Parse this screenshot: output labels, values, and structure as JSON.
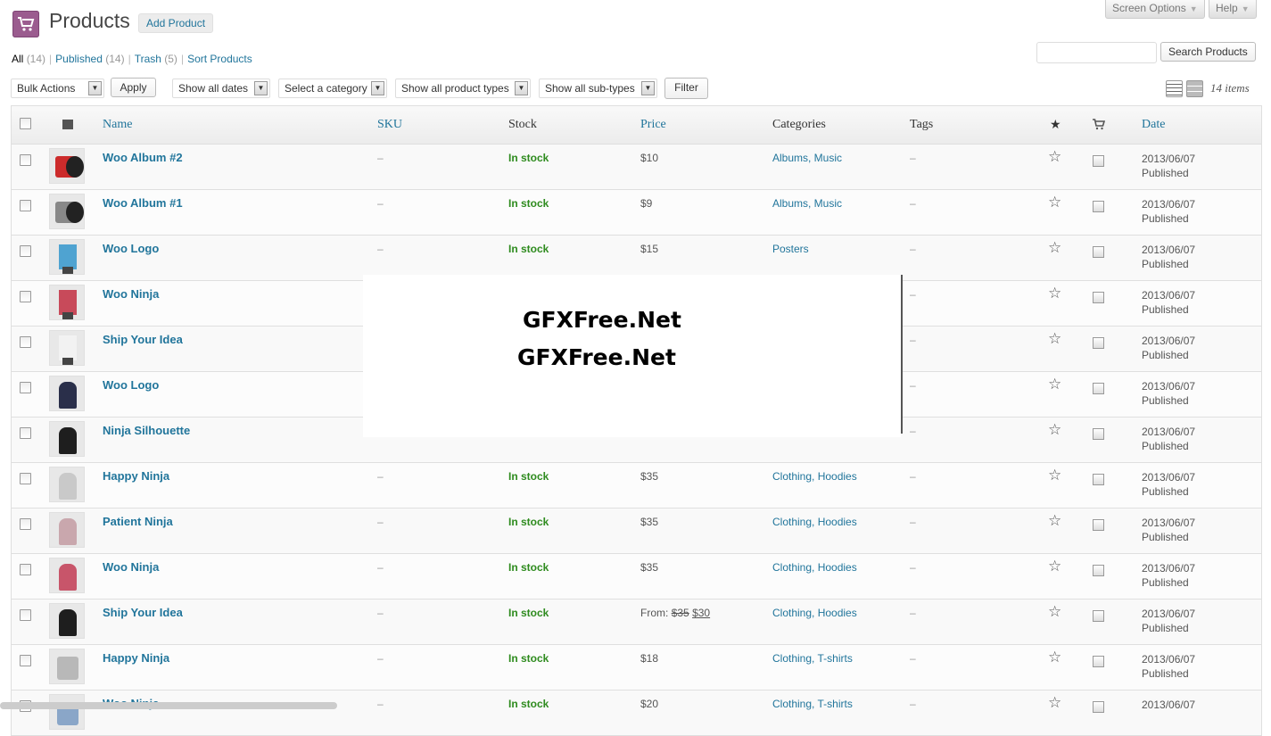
{
  "header": {
    "title": "Products",
    "add_label": "Add Product",
    "screen_options": "Screen Options",
    "help": "Help"
  },
  "filters": {
    "all": "All",
    "all_count": "(14)",
    "published": "Published",
    "published_count": "(14)",
    "trash": "Trash",
    "trash_count": "(5)",
    "sort": "Sort Products"
  },
  "search": {
    "button": "Search Products",
    "value": ""
  },
  "toolbar": {
    "bulk": "Bulk Actions",
    "apply": "Apply",
    "dates": "Show all dates",
    "category": "Select a category",
    "types": "Show all product types",
    "subtypes": "Show all sub-types",
    "filter": "Filter",
    "items": "14 items"
  },
  "columns": {
    "name": "Name",
    "sku": "SKU",
    "stock": "Stock",
    "price": "Price",
    "categories": "Categories",
    "tags": "Tags",
    "date": "Date"
  },
  "watermark": {
    "line1": "GFXFree.Net",
    "line2": "GFXFree.Net"
  },
  "rows": [
    {
      "name": "Woo Album #2",
      "sku": "–",
      "stock": "In stock",
      "price": "$10",
      "cats": "Albums, Music",
      "tags": "–",
      "date": "2013/06/07",
      "status": "Published",
      "thumb": "album-red"
    },
    {
      "name": "Woo Album #1",
      "sku": "–",
      "stock": "In stock",
      "price": "$9",
      "cats": "Albums, Music",
      "tags": "–",
      "date": "2013/06/07",
      "status": "Published",
      "thumb": "album-grey"
    },
    {
      "name": "Woo Logo",
      "sku": "–",
      "stock": "In stock",
      "price": "$15",
      "cats": "Posters",
      "tags": "–",
      "date": "2013/06/07",
      "status": "Published",
      "thumb": "poster"
    },
    {
      "name": "Woo Ninja",
      "sku": "",
      "stock": "",
      "price": "",
      "cats": "",
      "tags": "–",
      "date": "2013/06/07",
      "status": "Published",
      "thumb": "poster-red"
    },
    {
      "name": "Ship Your Idea",
      "sku": "",
      "stock": "",
      "price": "",
      "cats": "",
      "tags": "–",
      "date": "2013/06/07",
      "status": "Published",
      "thumb": "poster-white"
    },
    {
      "name": "Woo Logo",
      "sku": "",
      "stock": "",
      "price": "",
      "cats": "",
      "tags": "–",
      "date": "2013/06/07",
      "status": "Published",
      "thumb": "hoodie-navy"
    },
    {
      "name": "Ninja Silhouette",
      "sku": "",
      "stock": "",
      "price": "",
      "cats": "",
      "tags": "–",
      "date": "2013/06/07",
      "status": "Published",
      "thumb": "hoodie-black"
    },
    {
      "name": "Happy Ninja",
      "sku": "–",
      "stock": "In stock",
      "price": "$35",
      "cats": "Clothing, Hoodies",
      "tags": "–",
      "date": "2013/06/07",
      "status": "Published",
      "thumb": "hoodie-grey"
    },
    {
      "name": "Patient Ninja",
      "sku": "–",
      "stock": "In stock",
      "price": "$35",
      "cats": "Clothing, Hoodies",
      "tags": "–",
      "date": "2013/06/07",
      "status": "Published",
      "thumb": "hoodie-pink"
    },
    {
      "name": "Woo Ninja",
      "sku": "–",
      "stock": "In stock",
      "price": "$35",
      "cats": "Clothing, Hoodies",
      "tags": "–",
      "date": "2013/06/07",
      "status": "Published",
      "thumb": "hoodie-red"
    },
    {
      "name": "Ship Your Idea",
      "sku": "–",
      "stock": "In stock",
      "price_prefix": "From:",
      "price_old": "$35",
      "price_new": "$30",
      "cats": "Clothing, Hoodies",
      "tags": "–",
      "date": "2013/06/07",
      "status": "Published",
      "thumb": "hoodie-black"
    },
    {
      "name": "Happy Ninja",
      "sku": "–",
      "stock": "In stock",
      "price": "$18",
      "cats": "Clothing, T-shirts",
      "tags": "–",
      "date": "2013/06/07",
      "status": "Published",
      "thumb": "tshirt-grey"
    },
    {
      "name": "Woo Ninja",
      "sku": "–",
      "stock": "In stock",
      "price": "$20",
      "cats": "Clothing, T-shirts",
      "tags": "–",
      "date": "2013/06/07",
      "status": "",
      "thumb": "tshirt-blue"
    }
  ],
  "colors": {
    "brand": "#9b5c8f",
    "link": "#21759b",
    "in_stock": "#2e8b1e"
  }
}
